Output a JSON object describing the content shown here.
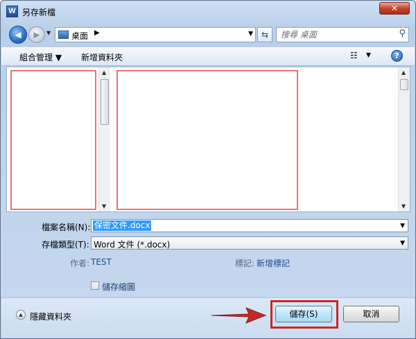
{
  "window": {
    "app_icon_letter": "W",
    "title": "另存新檔",
    "close_glyph": "✕"
  },
  "address_bar": {
    "location": "桌面",
    "crumb_arrow": "▶",
    "search_placeholder": "搜尋 桌面"
  },
  "toolbar": {
    "organize_label": "組合管理 ▼",
    "new_folder_label": "新增資料夾",
    "help_glyph": "?"
  },
  "form": {
    "filename_label": "檔案名稱(N):",
    "filename_value": "保密文件.docx",
    "filetype_label": "存檔類型(T):",
    "filetype_value": "Word 文件 (*.docx)",
    "authors_label": "作者:",
    "authors_value": "TEST",
    "tags_label": "標記:",
    "tags_value": "新增標記",
    "thumbnail_label": "儲存縮圖"
  },
  "footer": {
    "hide_folders_label": "隱藏資料夾",
    "save_label": "儲存(S)",
    "cancel_label": "取消"
  },
  "colors": {
    "highlight_border": "#e77373",
    "annotation_red": "#c62828"
  },
  "icons": [
    "word-app-icon",
    "close-icon",
    "back-arrow-icon",
    "forward-arrow-icon",
    "computer-icon",
    "refresh-icon",
    "search-icon",
    "view-options-icon",
    "help-icon",
    "checkbox-icon",
    "collapse-chevron-icon",
    "red-pointer-arrow"
  ]
}
